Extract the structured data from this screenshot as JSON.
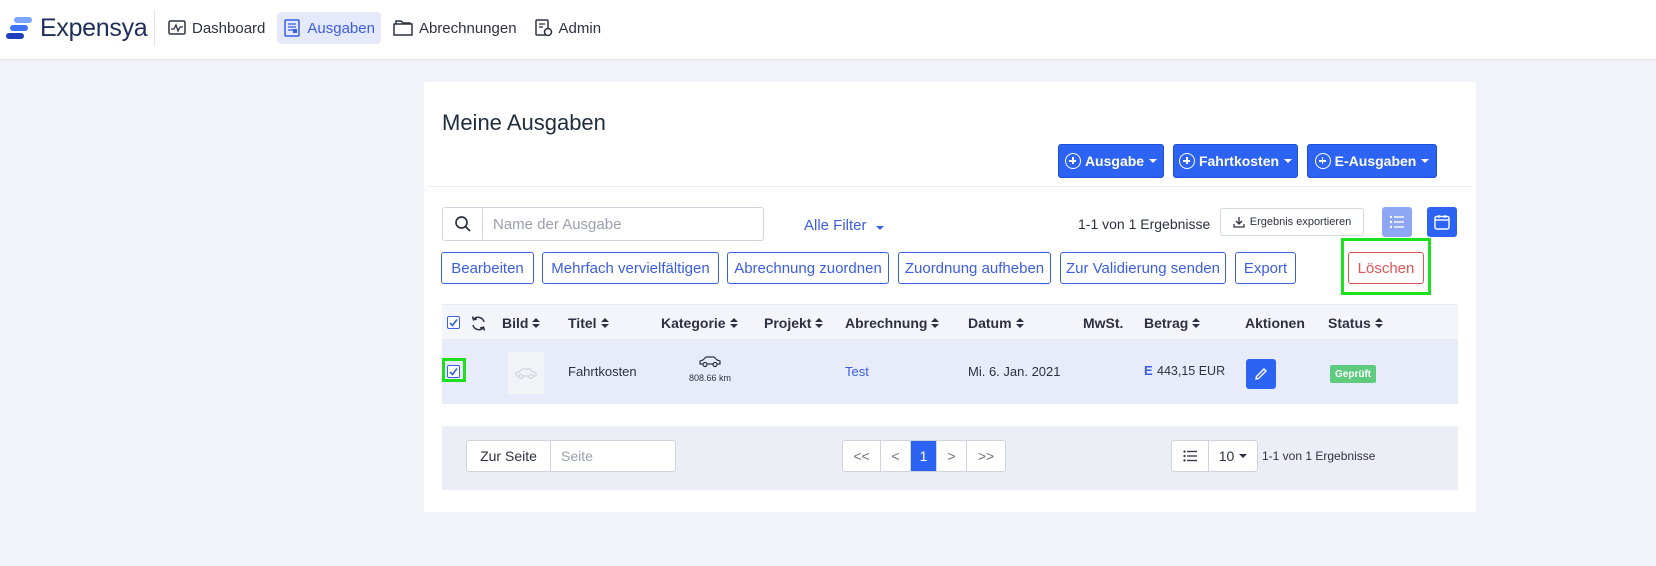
{
  "app": {
    "name": "Expensya"
  },
  "nav": {
    "items": [
      {
        "label": "Dashboard",
        "icon": "dashboard-icon",
        "active": false
      },
      {
        "label": "Ausgaben",
        "icon": "receipt-icon",
        "active": true
      },
      {
        "label": "Abrechnungen",
        "icon": "folder-icon",
        "active": false
      },
      {
        "label": "Admin",
        "icon": "admin-icon",
        "active": false
      }
    ]
  },
  "page": {
    "title": "Meine Ausgaben"
  },
  "create_buttons": {
    "expense": "Ausgabe",
    "mileage": "Fahrtkosten",
    "e_expenses": "E-Ausgaben"
  },
  "search": {
    "placeholder": "Name der Ausgabe",
    "value": ""
  },
  "filter": {
    "label": "Alle Filter"
  },
  "results": {
    "summary": "1-1 von 1 Ergebnisse",
    "export_label": "Ergebnis exportieren"
  },
  "actions": {
    "edit": "Bearbeiten",
    "duplicate": "Mehrfach vervielfältigen",
    "assign_report": "Abrechnung zuordnen",
    "unassign": "Zuordnung aufheben",
    "send_validation": "Zur Validierung senden",
    "export": "Export",
    "delete": "Löschen"
  },
  "table": {
    "columns": {
      "image": "Bild",
      "title": "Titel",
      "category": "Kategorie",
      "project": "Projekt",
      "report": "Abrechnung",
      "date": "Datum",
      "vat": "MwSt.",
      "amount": "Betrag",
      "actions": "Aktionen",
      "status": "Status"
    },
    "rows": [
      {
        "selected": true,
        "title": "Fahrtkosten",
        "category_icon": "car-icon",
        "category_detail": "808.66 km",
        "project": "",
        "report": "Test",
        "date": "Mi. 6. Jan. 2021",
        "vat": "",
        "amount_prefix": "E",
        "amount": "443,15 EUR",
        "status": "Geprüft"
      }
    ]
  },
  "pagination": {
    "goto_label": "Zur Seite",
    "goto_placeholder": "Seite",
    "first": "<<",
    "prev": "<",
    "current": "1",
    "next": ">",
    "last": ">>",
    "per_page": "10",
    "summary": "1-1 von 1 Ergebnisse"
  },
  "colors": {
    "primary": "#2d63f2",
    "danger": "#e55353",
    "success": "#5ecb7f",
    "highlight": "#1ee01e"
  }
}
